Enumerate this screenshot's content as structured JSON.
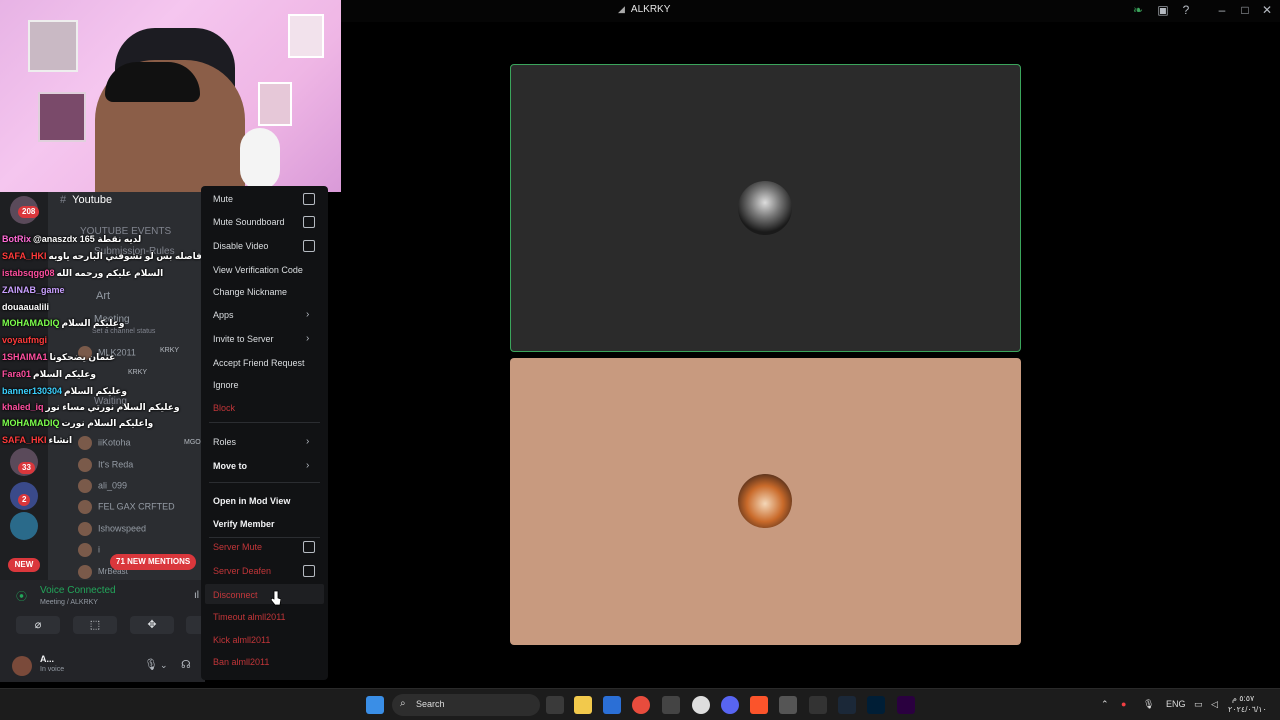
{
  "window": {
    "title": "ALKRKY",
    "controls": [
      "minimize",
      "maximize",
      "close"
    ]
  },
  "left_panel": {
    "channel_header": "Youtube",
    "channels": [
      "YOUTUBE EVENTS",
      "Submission-Rules",
      "Art",
      "Meeting",
      "Set a channel status",
      "Waiting"
    ],
    "server_badges": [
      "208",
      "33",
      "2"
    ],
    "new_pill": "NEW",
    "new_mentions": "71 NEW MENTIONS",
    "voice_users": [
      "MLK2011",
      "iiKotoha",
      "It's Reda",
      "ali_099",
      "FEL GAX CRFTED",
      "Ishowspeed",
      "i",
      "MrBeast"
    ],
    "voice_user_tags": [
      "KRKY",
      "KRKY",
      "MGO"
    ]
  },
  "chat": [
    {
      "user": "BotRix",
      "color": "#ff6bd6",
      "msg": "@anaszdx 165 لديه نقطة"
    },
    {
      "user": "SAFA_HKI",
      "color": "#ff3b3b",
      "msg": "لا بس اليوم فاصله بس لو تشوفني البارحه ياويه"
    },
    {
      "user": "istabsqgg08",
      "color": "#ff4fa0",
      "msg": "السلام عليكم ورحمه الله"
    },
    {
      "user": "ZAINAB_game",
      "color": "#c9a0ff",
      "msg": ""
    },
    {
      "user": "douaaualili",
      "color": "#ffffff",
      "msg": ""
    },
    {
      "user": "MOHAMADIQ",
      "color": "#7dff4d",
      "msg": "وعليكم السلام"
    },
    {
      "user": "voyaufmgi",
      "color": "#ff3b3b",
      "msg": ""
    },
    {
      "user": "1SHAIMA1",
      "color": "#ff4fa0",
      "msg": "عثمان يضحكونا"
    },
    {
      "user": "Fara01",
      "color": "#ff4fa0",
      "msg": "وعليكم السلام"
    },
    {
      "user": "banner130304",
      "color": "#3bd1ff",
      "msg": "وعليكم السلام"
    },
    {
      "user": "khaled_iq",
      "color": "#ff4fa0",
      "msg": "وعليكم السلام نورتي مساء نور"
    },
    {
      "user": "MOHAMADIQ",
      "color": "#7dff4d",
      "msg": "واعليكم السلام نورت"
    },
    {
      "user": "SAFA_HKI",
      "color": "#ff3b3b",
      "msg": "انشاء"
    }
  ],
  "voice_panel": {
    "status": "Voice Connected",
    "location": "Meeting / ALKRKY",
    "user_name": "A...",
    "user_status": "In voice"
  },
  "context_menu": {
    "items": [
      {
        "label": "Mute",
        "type": "check"
      },
      {
        "label": "Mute Soundboard",
        "type": "check"
      },
      {
        "label": "Disable Video",
        "type": "check"
      },
      {
        "label": "View Verification Code",
        "type": "plain"
      },
      {
        "label": "Change Nickname",
        "type": "plain"
      },
      {
        "label": "Apps",
        "type": "submenu"
      },
      {
        "label": "Invite to Server",
        "type": "submenu"
      },
      {
        "label": "Accept Friend Request",
        "type": "plain"
      },
      {
        "label": "Ignore",
        "type": "plain"
      },
      {
        "label": "Block",
        "type": "danger"
      },
      {
        "label": "Roles",
        "type": "submenu"
      },
      {
        "label": "Move to",
        "type": "submenu-bold"
      },
      {
        "label": "Open in Mod View",
        "type": "bold"
      },
      {
        "label": "Verify Member",
        "type": "bold"
      },
      {
        "label": "Server Mute",
        "type": "danger-check"
      },
      {
        "label": "Server Deafen",
        "type": "danger-check"
      },
      {
        "label": "Disconnect",
        "type": "danger-hover"
      },
      {
        "label": "Timeout almll2011",
        "type": "danger"
      },
      {
        "label": "Kick almll2011",
        "type": "danger"
      },
      {
        "label": "Ban almll2011",
        "type": "danger"
      }
    ]
  },
  "taskbar": {
    "search_label": "Search",
    "lang": "ENG",
    "clock_time": "٥:٥٧ م",
    "clock_date": "٢٠٢٤/٠٦/١٠"
  },
  "colors": {
    "speaking_border": "#3ba55c",
    "danger": "#f23f43",
    "voice_green": "#23a55a"
  }
}
